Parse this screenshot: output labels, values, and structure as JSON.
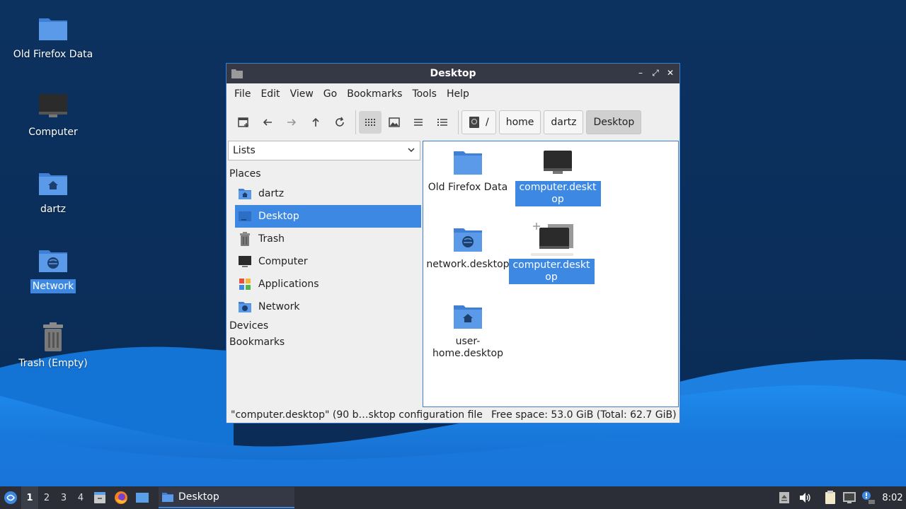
{
  "desktop": {
    "icons": [
      {
        "label": "Old Firefox Data"
      },
      {
        "label": "Computer"
      },
      {
        "label": "dartz"
      },
      {
        "label": "Network"
      },
      {
        "label": "Trash (Empty)"
      }
    ]
  },
  "window": {
    "title": "Desktop",
    "controls": {
      "minimize": "–",
      "maximize": "⤢",
      "close": "✕"
    }
  },
  "menubar": {
    "items": [
      {
        "label": "File"
      },
      {
        "label": "Edit"
      },
      {
        "label": "View"
      },
      {
        "label": "Go"
      },
      {
        "label": "Bookmarks"
      },
      {
        "label": "Tools"
      },
      {
        "label": "Help"
      }
    ]
  },
  "breadcrumb": {
    "root": "/",
    "items": [
      {
        "label": "home"
      },
      {
        "label": "dartz"
      },
      {
        "label": "Desktop"
      }
    ]
  },
  "sidebar": {
    "select_value": "Lists",
    "places_label": "Places",
    "places": [
      {
        "label": "dartz"
      },
      {
        "label": "Desktop"
      },
      {
        "label": "Trash"
      },
      {
        "label": "Computer"
      },
      {
        "label": "Applications"
      },
      {
        "label": "Network"
      }
    ],
    "devices_label": "Devices",
    "bookmarks_label": "Bookmarks"
  },
  "files": [
    {
      "label": "Old Firefox Data"
    },
    {
      "label": "computer.desktop"
    },
    {
      "label": "network.desktop"
    },
    {
      "label": "computer.desktop"
    },
    {
      "label": "user-home.desktop"
    }
  ],
  "status": {
    "left": "\"computer.desktop\" (90 b…sktop configuration file",
    "right": "Free space: 53.0 GiB (Total: 62.7 GiB)"
  },
  "taskbar": {
    "workspaces": [
      "1",
      "2",
      "3",
      "4"
    ],
    "task_label": "Desktop",
    "clock": "8:02"
  },
  "colors": {
    "accent": "#3c88e3",
    "titlebar": "#353945",
    "taskbar": "#2b2e37",
    "folder": "#4a86d9"
  }
}
